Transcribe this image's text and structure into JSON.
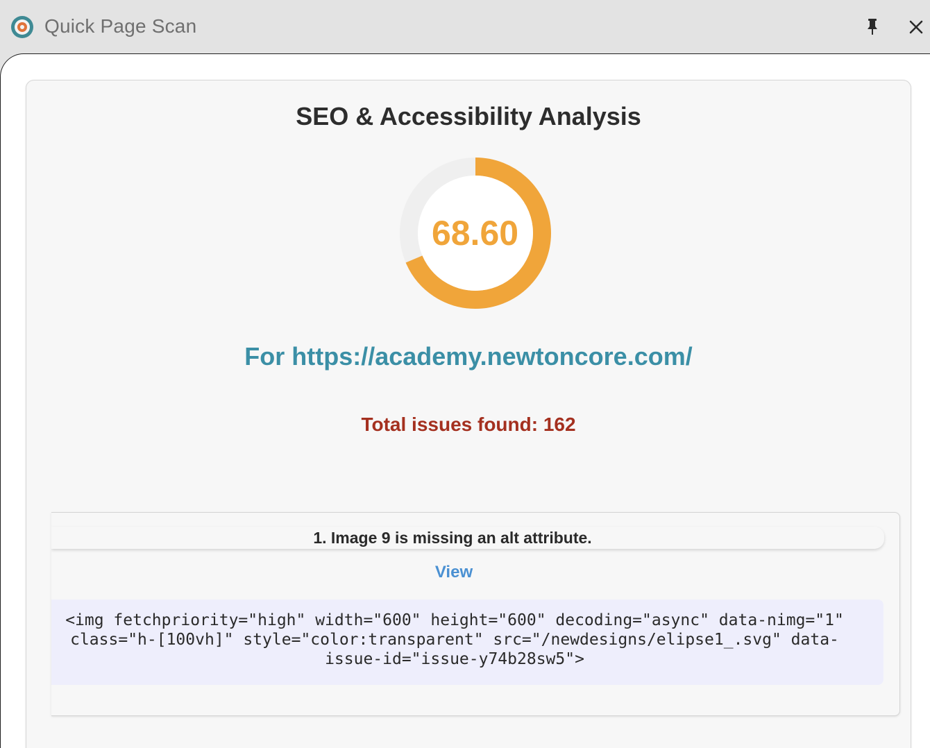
{
  "window": {
    "title": "Quick Page Scan",
    "logo_icon": "target-logo-icon",
    "pin_icon": "pin-icon",
    "close_icon": "close-icon"
  },
  "report": {
    "heading": "SEO & Accessibility Analysis",
    "score": "68.60",
    "score_fraction": 0.686,
    "score_color": "#f0a53a",
    "url_line": "For https://academy.newtoncore.com/",
    "total_issues": "Total issues found: 162"
  },
  "issue": {
    "title": "1. Image 9 is missing an alt attribute.",
    "view_label": "View",
    "code_snippet": "<img fetchpriority=\"high\" width=\"600\" height=\"600\" decoding=\"async\" data-nimg=\"1\" class=\"h-[100vh]\" style=\"color:transparent\" src=\"/newdesigns/elipse1_.svg\" data-issue-id=\"issue-y74b28sw5\">"
  },
  "colors": {
    "accent_url": "#3b8fa6",
    "issues_red": "#a4301f",
    "link_blue": "#4a90d2",
    "code_bg": "#eeeefc"
  }
}
